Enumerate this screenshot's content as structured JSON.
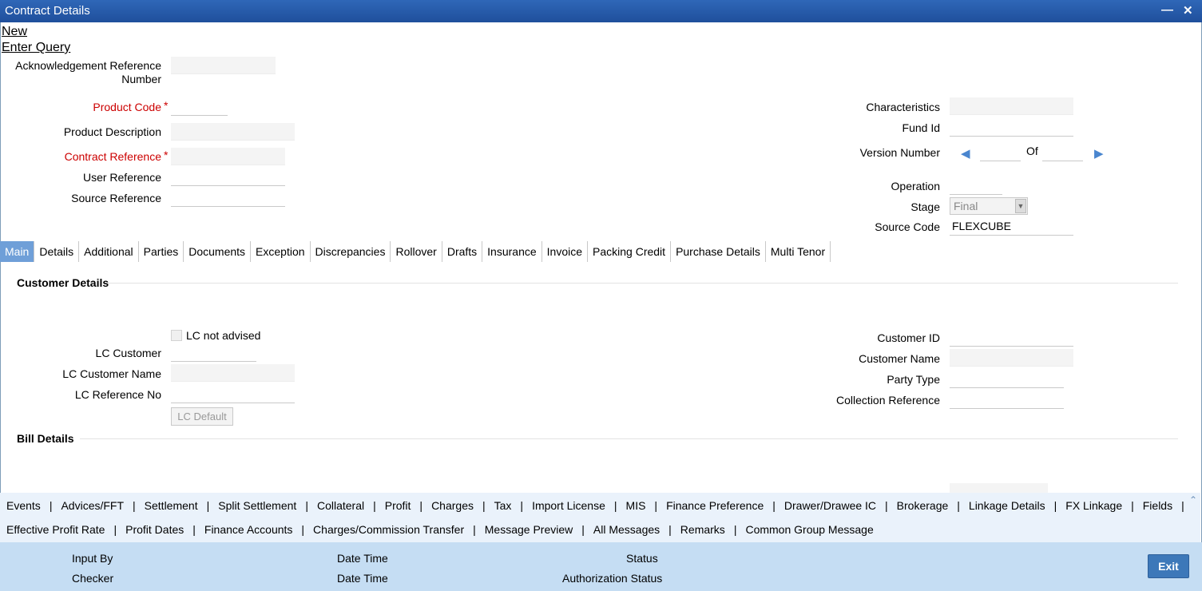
{
  "window": {
    "title": "Contract Details",
    "minimize_icon": "minimize-icon",
    "close_icon": "close-icon"
  },
  "actions": {
    "new": "New",
    "enter_query": "Enter Query"
  },
  "header_left": {
    "ack_ref_label_1": "Acknowledgement Reference",
    "ack_ref_label_2": "Number",
    "product_code_label": "Product Code",
    "product_description_label": "Product Description",
    "contract_reference_label": "Contract Reference",
    "user_reference_label": "User Reference",
    "source_reference_label": "Source Reference",
    "required_marker": "*"
  },
  "header_right": {
    "characteristics_label": "Characteristics",
    "fund_id_label": "Fund Id",
    "version_number_label": "Version Number",
    "of_label": "Of",
    "operation_label": "Operation",
    "stage_label": "Stage",
    "stage_value": "Final",
    "source_code_label": "Source Code",
    "source_code_value": "FLEXCUBE"
  },
  "tabs": [
    "Main",
    "Details",
    "Additional",
    "Parties",
    "Documents",
    "Exception",
    "Discrepancies",
    "Rollover",
    "Drafts",
    "Insurance",
    "Invoice",
    "Packing Credit",
    "Purchase Details",
    "Multi Tenor"
  ],
  "active_tab": "Main",
  "customer_details": {
    "title": "Customer Details",
    "lc_not_advised_label": "LC not advised",
    "lc_customer_label": "LC Customer",
    "lc_customer_name_label": "LC Customer Name",
    "lc_reference_no_label": "LC Reference No",
    "lc_default_button": "LC Default",
    "customer_id_label": "Customer ID",
    "customer_name_label": "Customer Name",
    "party_type_label": "Party Type",
    "collection_reference_label": "Collection Reference"
  },
  "bill_details": {
    "title": "Bill Details"
  },
  "subsystems_row1": [
    "Events",
    "Advices/FFT",
    "Settlement",
    "Split Settlement",
    "Collateral",
    "Profit",
    "Charges",
    "Tax",
    "Import License",
    "MIS",
    "Finance Preference",
    "Drawer/Drawee IC",
    "Brokerage",
    "Linkage Details",
    "FX Linkage",
    "Fields"
  ],
  "subsystems_row2": [
    "Effective Profit Rate",
    "Profit Dates",
    "Finance Accounts",
    "Charges/Commission Transfer",
    "Message Preview",
    "All Messages",
    "Remarks",
    "Common Group Message"
  ],
  "footer": {
    "input_by": "Input By",
    "checker": "Checker",
    "date_time_1": "Date Time",
    "date_time_2": "Date Time",
    "status": "Status",
    "authorization_status": "Authorization Status",
    "exit": "Exit"
  },
  "colors": {
    "title_bar": "#2f67b8",
    "active_tab": "#6f9fd8",
    "footer": "#c5ddf3",
    "exit_button": "#3d78b9",
    "required": "#cc0000"
  }
}
